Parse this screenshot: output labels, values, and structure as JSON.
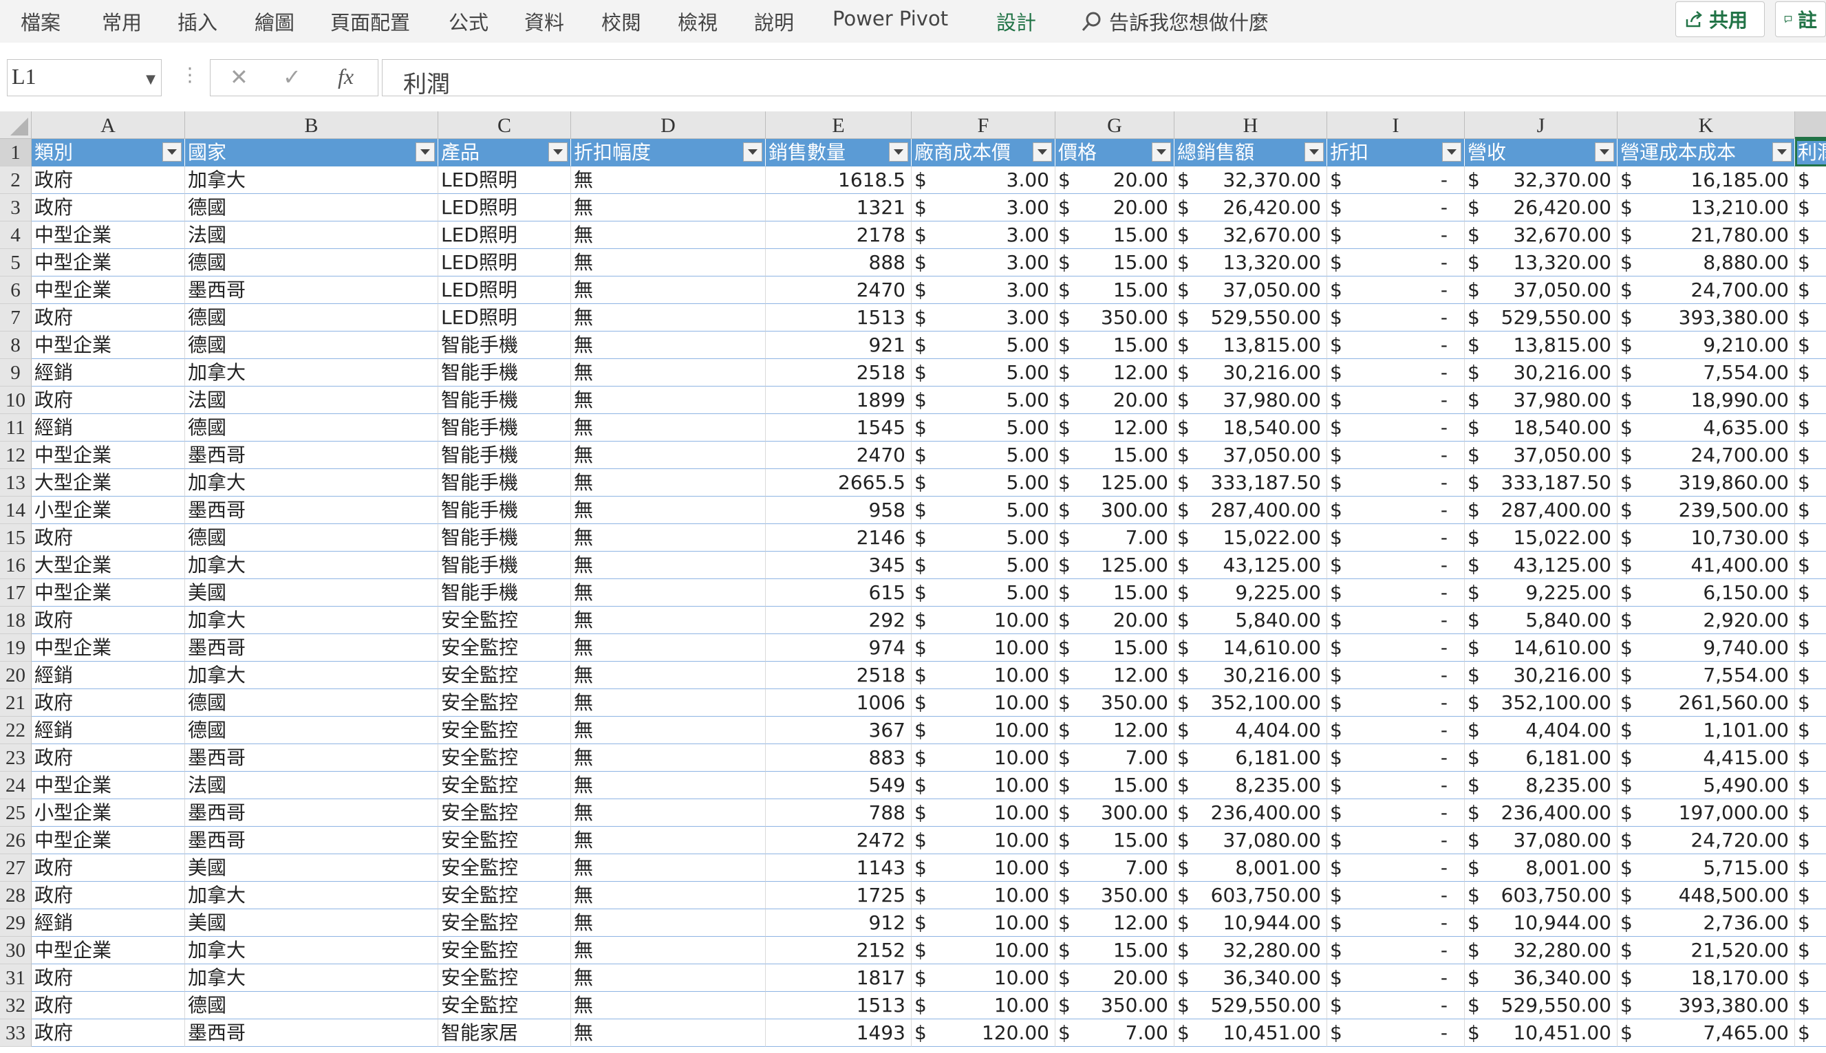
{
  "ribbon": {
    "tabs": [
      "檔案",
      "常用",
      "插入",
      "繪圖",
      "頁面配置",
      "公式",
      "資料",
      "校閱",
      "檢視",
      "說明",
      "Power Pivot",
      "設計"
    ],
    "active_tab": "設計",
    "search_text": "告訴我您想做什麼",
    "share_label": "共用",
    "comments_label": "註",
    "accent_color": "#217346"
  },
  "formula_bar": {
    "name_box": "L1",
    "formula": "利潤",
    "fx_label": "fx"
  },
  "sheet": {
    "column_letters": [
      "A",
      "B",
      "C",
      "D",
      "E",
      "F",
      "G",
      "H",
      "I",
      "J",
      "K",
      ""
    ],
    "headers": [
      "類別",
      "國家",
      "產品",
      "折扣幅度",
      "銷售數量",
      "廠商成本價",
      "價格",
      "總銷售額",
      "折扣",
      "營收",
      "營運成本成本",
      "利潤"
    ],
    "currency_symbol": "$",
    "dash": "-",
    "rows": [
      [
        "政府",
        "加拿大",
        "LED照明",
        "無",
        "1618.5",
        "3.00",
        "20.00",
        "32,370.00",
        "-",
        "32,370.00",
        "16,185.00"
      ],
      [
        "政府",
        "德國",
        "LED照明",
        "無",
        "1321",
        "3.00",
        "20.00",
        "26,420.00",
        "-",
        "26,420.00",
        "13,210.00"
      ],
      [
        "中型企業",
        "法國",
        "LED照明",
        "無",
        "2178",
        "3.00",
        "15.00",
        "32,670.00",
        "-",
        "32,670.00",
        "21,780.00"
      ],
      [
        "中型企業",
        "德國",
        "LED照明",
        "無",
        "888",
        "3.00",
        "15.00",
        "13,320.00",
        "-",
        "13,320.00",
        "8,880.00"
      ],
      [
        "中型企業",
        "墨西哥",
        "LED照明",
        "無",
        "2470",
        "3.00",
        "15.00",
        "37,050.00",
        "-",
        "37,050.00",
        "24,700.00"
      ],
      [
        "政府",
        "德國",
        "LED照明",
        "無",
        "1513",
        "3.00",
        "350.00",
        "529,550.00",
        "-",
        "529,550.00",
        "393,380.00"
      ],
      [
        "中型企業",
        "德國",
        "智能手機",
        "無",
        "921",
        "5.00",
        "15.00",
        "13,815.00",
        "-",
        "13,815.00",
        "9,210.00"
      ],
      [
        "經銷",
        "加拿大",
        "智能手機",
        "無",
        "2518",
        "5.00",
        "12.00",
        "30,216.00",
        "-",
        "30,216.00",
        "7,554.00"
      ],
      [
        "政府",
        "法國",
        "智能手機",
        "無",
        "1899",
        "5.00",
        "20.00",
        "37,980.00",
        "-",
        "37,980.00",
        "18,990.00"
      ],
      [
        "經銷",
        "德國",
        "智能手機",
        "無",
        "1545",
        "5.00",
        "12.00",
        "18,540.00",
        "-",
        "18,540.00",
        "4,635.00"
      ],
      [
        "中型企業",
        "墨西哥",
        "智能手機",
        "無",
        "2470",
        "5.00",
        "15.00",
        "37,050.00",
        "-",
        "37,050.00",
        "24,700.00"
      ],
      [
        "大型企業",
        "加拿大",
        "智能手機",
        "無",
        "2665.5",
        "5.00",
        "125.00",
        "333,187.50",
        "-",
        "333,187.50",
        "319,860.00"
      ],
      [
        "小型企業",
        "墨西哥",
        "智能手機",
        "無",
        "958",
        "5.00",
        "300.00",
        "287,400.00",
        "-",
        "287,400.00",
        "239,500.00"
      ],
      [
        "政府",
        "德國",
        "智能手機",
        "無",
        "2146",
        "5.00",
        "7.00",
        "15,022.00",
        "-",
        "15,022.00",
        "10,730.00"
      ],
      [
        "大型企業",
        "加拿大",
        "智能手機",
        "無",
        "345",
        "5.00",
        "125.00",
        "43,125.00",
        "-",
        "43,125.00",
        "41,400.00"
      ],
      [
        "中型企業",
        "美國",
        "智能手機",
        "無",
        "615",
        "5.00",
        "15.00",
        "9,225.00",
        "-",
        "9,225.00",
        "6,150.00"
      ],
      [
        "政府",
        "加拿大",
        "安全監控",
        "無",
        "292",
        "10.00",
        "20.00",
        "5,840.00",
        "-",
        "5,840.00",
        "2,920.00"
      ],
      [
        "中型企業",
        "墨西哥",
        "安全監控",
        "無",
        "974",
        "10.00",
        "15.00",
        "14,610.00",
        "-",
        "14,610.00",
        "9,740.00"
      ],
      [
        "經銷",
        "加拿大",
        "安全監控",
        "無",
        "2518",
        "10.00",
        "12.00",
        "30,216.00",
        "-",
        "30,216.00",
        "7,554.00"
      ],
      [
        "政府",
        "德國",
        "安全監控",
        "無",
        "1006",
        "10.00",
        "350.00",
        "352,100.00",
        "-",
        "352,100.00",
        "261,560.00"
      ],
      [
        "經銷",
        "德國",
        "安全監控",
        "無",
        "367",
        "10.00",
        "12.00",
        "4,404.00",
        "-",
        "4,404.00",
        "1,101.00"
      ],
      [
        "政府",
        "墨西哥",
        "安全監控",
        "無",
        "883",
        "10.00",
        "7.00",
        "6,181.00",
        "-",
        "6,181.00",
        "4,415.00"
      ],
      [
        "中型企業",
        "法國",
        "安全監控",
        "無",
        "549",
        "10.00",
        "15.00",
        "8,235.00",
        "-",
        "8,235.00",
        "5,490.00"
      ],
      [
        "小型企業",
        "墨西哥",
        "安全監控",
        "無",
        "788",
        "10.00",
        "300.00",
        "236,400.00",
        "-",
        "236,400.00",
        "197,000.00"
      ],
      [
        "中型企業",
        "墨西哥",
        "安全監控",
        "無",
        "2472",
        "10.00",
        "15.00",
        "37,080.00",
        "-",
        "37,080.00",
        "24,720.00"
      ],
      [
        "政府",
        "美國",
        "安全監控",
        "無",
        "1143",
        "10.00",
        "7.00",
        "8,001.00",
        "-",
        "8,001.00",
        "5,715.00"
      ],
      [
        "政府",
        "加拿大",
        "安全監控",
        "無",
        "1725",
        "10.00",
        "350.00",
        "603,750.00",
        "-",
        "603,750.00",
        "448,500.00"
      ],
      [
        "經銷",
        "美國",
        "安全監控",
        "無",
        "912",
        "10.00",
        "12.00",
        "10,944.00",
        "-",
        "10,944.00",
        "2,736.00"
      ],
      [
        "中型企業",
        "加拿大",
        "安全監控",
        "無",
        "2152",
        "10.00",
        "15.00",
        "32,280.00",
        "-",
        "32,280.00",
        "21,520.00"
      ],
      [
        "政府",
        "加拿大",
        "安全監控",
        "無",
        "1817",
        "10.00",
        "20.00",
        "36,340.00",
        "-",
        "36,340.00",
        "18,170.00"
      ],
      [
        "政府",
        "德國",
        "安全監控",
        "無",
        "1513",
        "10.00",
        "350.00",
        "529,550.00",
        "-",
        "529,550.00",
        "393,380.00"
      ],
      [
        "政府",
        "墨西哥",
        "智能家居",
        "無",
        "1493",
        "120.00",
        "7.00",
        "10,451.00",
        "-",
        "10,451.00",
        "7,465.00"
      ]
    ]
  }
}
